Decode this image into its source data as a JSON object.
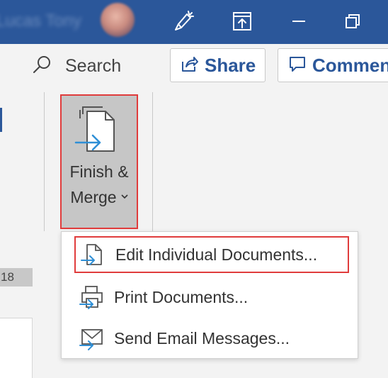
{
  "titlebar": {
    "user_name": "Lucas Tony",
    "icons": [
      "pen-icon",
      "upload-icon",
      "minimize-icon",
      "restore-icon"
    ]
  },
  "ribbon": {
    "search_label": "Search",
    "share_label": "Share",
    "comments_label": "Comments",
    "finish_merge_line1": "Finish &",
    "finish_merge_line2": "Merge"
  },
  "document": {
    "ruler_number": "18"
  },
  "menu": {
    "items": [
      {
        "label": "Edit Individual Documents...",
        "icon": "edit-documents-icon"
      },
      {
        "label": "Print Documents...",
        "icon": "print-icon"
      },
      {
        "label": "Send Email Messages...",
        "icon": "email-icon"
      }
    ]
  },
  "colors": {
    "titlebar": "#2b579a",
    "accent": "#2b579a",
    "highlight_border": "#e03c3c",
    "icon_blue": "#2e8fd6"
  }
}
